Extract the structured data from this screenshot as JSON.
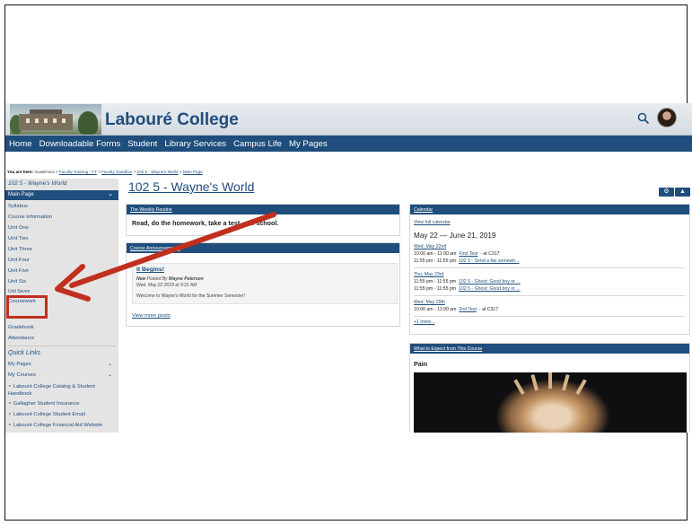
{
  "header": {
    "college_name": "Labouré College",
    "nav": [
      "Home",
      "Downloadable Forms",
      "Student",
      "Library Services",
      "Campus Life",
      "My Pages"
    ]
  },
  "breadcrumb": {
    "label": "You are here:",
    "items": [
      "Academics",
      "Faculty Training - FT",
      "Faculty Sandbox",
      "102 5 - Wayne's World",
      "Main Page"
    ]
  },
  "sidebar": {
    "course_title": "102 5 - Wayne's World",
    "main_page": "Main Page",
    "items": [
      "Syllabus",
      "Course Information",
      "Unit One",
      "Unit Two",
      "Unit Three",
      "Unit Four",
      "Unit Five",
      "Unit Six",
      "Unit Seven",
      "Coursework",
      "Gradebook",
      "Attendance"
    ],
    "quick_links_title": "Quick Links",
    "quick_links": [
      "My Pages",
      "My Courses"
    ],
    "external_links": [
      "Labouré College Catalog & Student Handbook",
      "Gallagher Student Insurance",
      "Labouré College Student Email",
      "Labouré College Financial Aid Website"
    ]
  },
  "main": {
    "page_title": "102 5 - Wayne's World",
    "weekly": {
      "heading": "The Weekly Routine",
      "body": "Read, do the homework, take a test, ace school."
    },
    "announcements": {
      "heading": "Course Announcements",
      "post_title": "It Begins!",
      "new_label": "New",
      "posted_by": "Posted By",
      "author": "Wayne Peterson",
      "date": "Wed, May 22 2019 at 9:31 AM",
      "body": "Welcome to Wayne's World for the Summer Semester!",
      "view_more": "View more posts"
    }
  },
  "calendar": {
    "heading": "Calendar",
    "view_full": "View full calendar",
    "range": "May 22 — June 21, 2019",
    "days": [
      {
        "date": "Wed, May 22nd",
        "events": [
          {
            "time": "10:00 am - 11:00 am",
            "title": "First Test",
            "where": "- at C317"
          },
          {
            "time": "11:55 pm - 11:55 pm",
            "title": "102 5 - Send a fax somewh...",
            "where": ""
          }
        ]
      },
      {
        "date": "Thu, May 23rd",
        "events": [
          {
            "time": "11:55 pm - 11:55 pm",
            "title": "102 5 - Ghost: Good boy or ...",
            "where": ""
          },
          {
            "time": "11:55 pm - 11:55 pm",
            "title": "102 5 - Ghost: Good boy or ...",
            "where": ""
          }
        ]
      },
      {
        "date": "Wed, May 29th",
        "events": [
          {
            "time": "10:00 am - 11:00 am",
            "title": "2nd Test",
            "where": "- at C317"
          }
        ]
      }
    ],
    "more": "+1 more..."
  },
  "expect": {
    "heading": "What to Expect from This Course",
    "subheading": "Pain"
  },
  "colors": {
    "brand": "#1f4e7d",
    "annotation": "#c0301f"
  }
}
